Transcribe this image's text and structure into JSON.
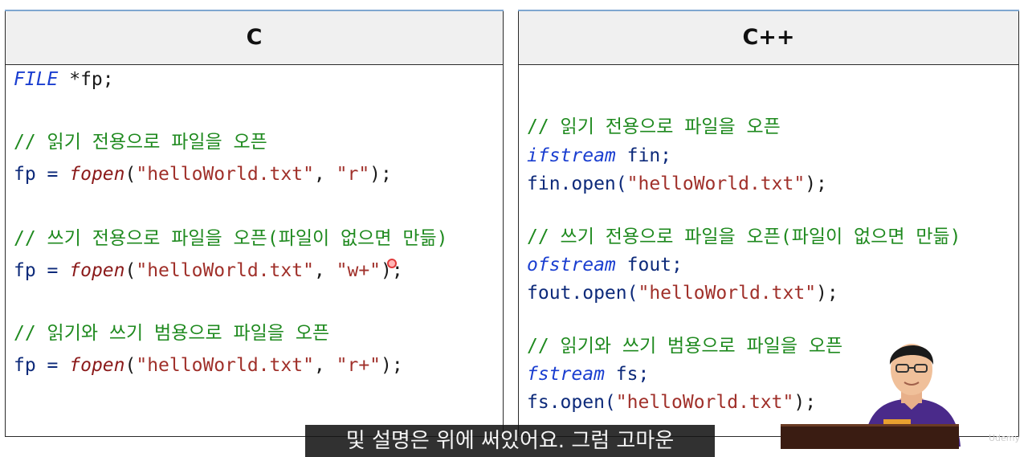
{
  "panels": {
    "c": {
      "title": "C",
      "lines": [
        {
          "type": "FILE",
          "rest": " *fp;"
        },
        {
          "comment": "// 읽기 전용으로 파일을 오픈"
        },
        {
          "a": "fp = ",
          "fn": "fopen",
          "b": "(",
          "s1": "\"helloWorld.txt\"",
          "c": ", ",
          "s2": "\"r\"",
          "d": ");"
        },
        {
          "comment": "// 쓰기 전용으로 파일을 오픈(파일이 없으면 만듦)"
        },
        {
          "a": "fp = ",
          "fn": "fopen",
          "b": "(",
          "s1": "\"helloWorld.txt\"",
          "c": ", ",
          "s2": "\"w+\"",
          "d": ");"
        },
        {
          "comment": "// 읽기와 쓰기 범용으로 파일을 오픈"
        },
        {
          "a": "fp = ",
          "fn": "fopen",
          "b": "(",
          "s1": "\"helloWorld.txt\"",
          "c": ", ",
          "s2": "\"r+\"",
          "d": ");"
        }
      ]
    },
    "cpp": {
      "title": "C++",
      "lines": [
        {
          "comment": "// 읽기 전용으로 파일을 오픈"
        },
        {
          "type": "ifstream",
          "rest": " fin;"
        },
        {
          "a": "fin.open(",
          "s1": "\"helloWorld.txt\"",
          "d": ");"
        },
        {
          "comment": "// 쓰기 전용으로 파일을 오픈(파일이 없으면 만듦)"
        },
        {
          "type": "ofstream",
          "rest": " fout;"
        },
        {
          "a": "fout.open(",
          "s1": "\"helloWorld.txt\"",
          "d": ");"
        },
        {
          "comment": "// 읽기와 쓰기 범용으로 파일을 오픈"
        },
        {
          "type": "fstream",
          "rest": " fs;"
        },
        {
          "a": "fs.open(",
          "s1": "\"helloWorld.txt\"",
          "d": ");"
        }
      ]
    }
  },
  "subtitle": "및 설명은 위에 써있어요. 그럼 고마운",
  "watermark": "Udemy",
  "colors": {
    "comment": "#1f8a1f",
    "type": "#1a3ed0",
    "function": "#8b1a1a",
    "string": "#a0302a",
    "header_bg": "#f0f0f0"
  }
}
